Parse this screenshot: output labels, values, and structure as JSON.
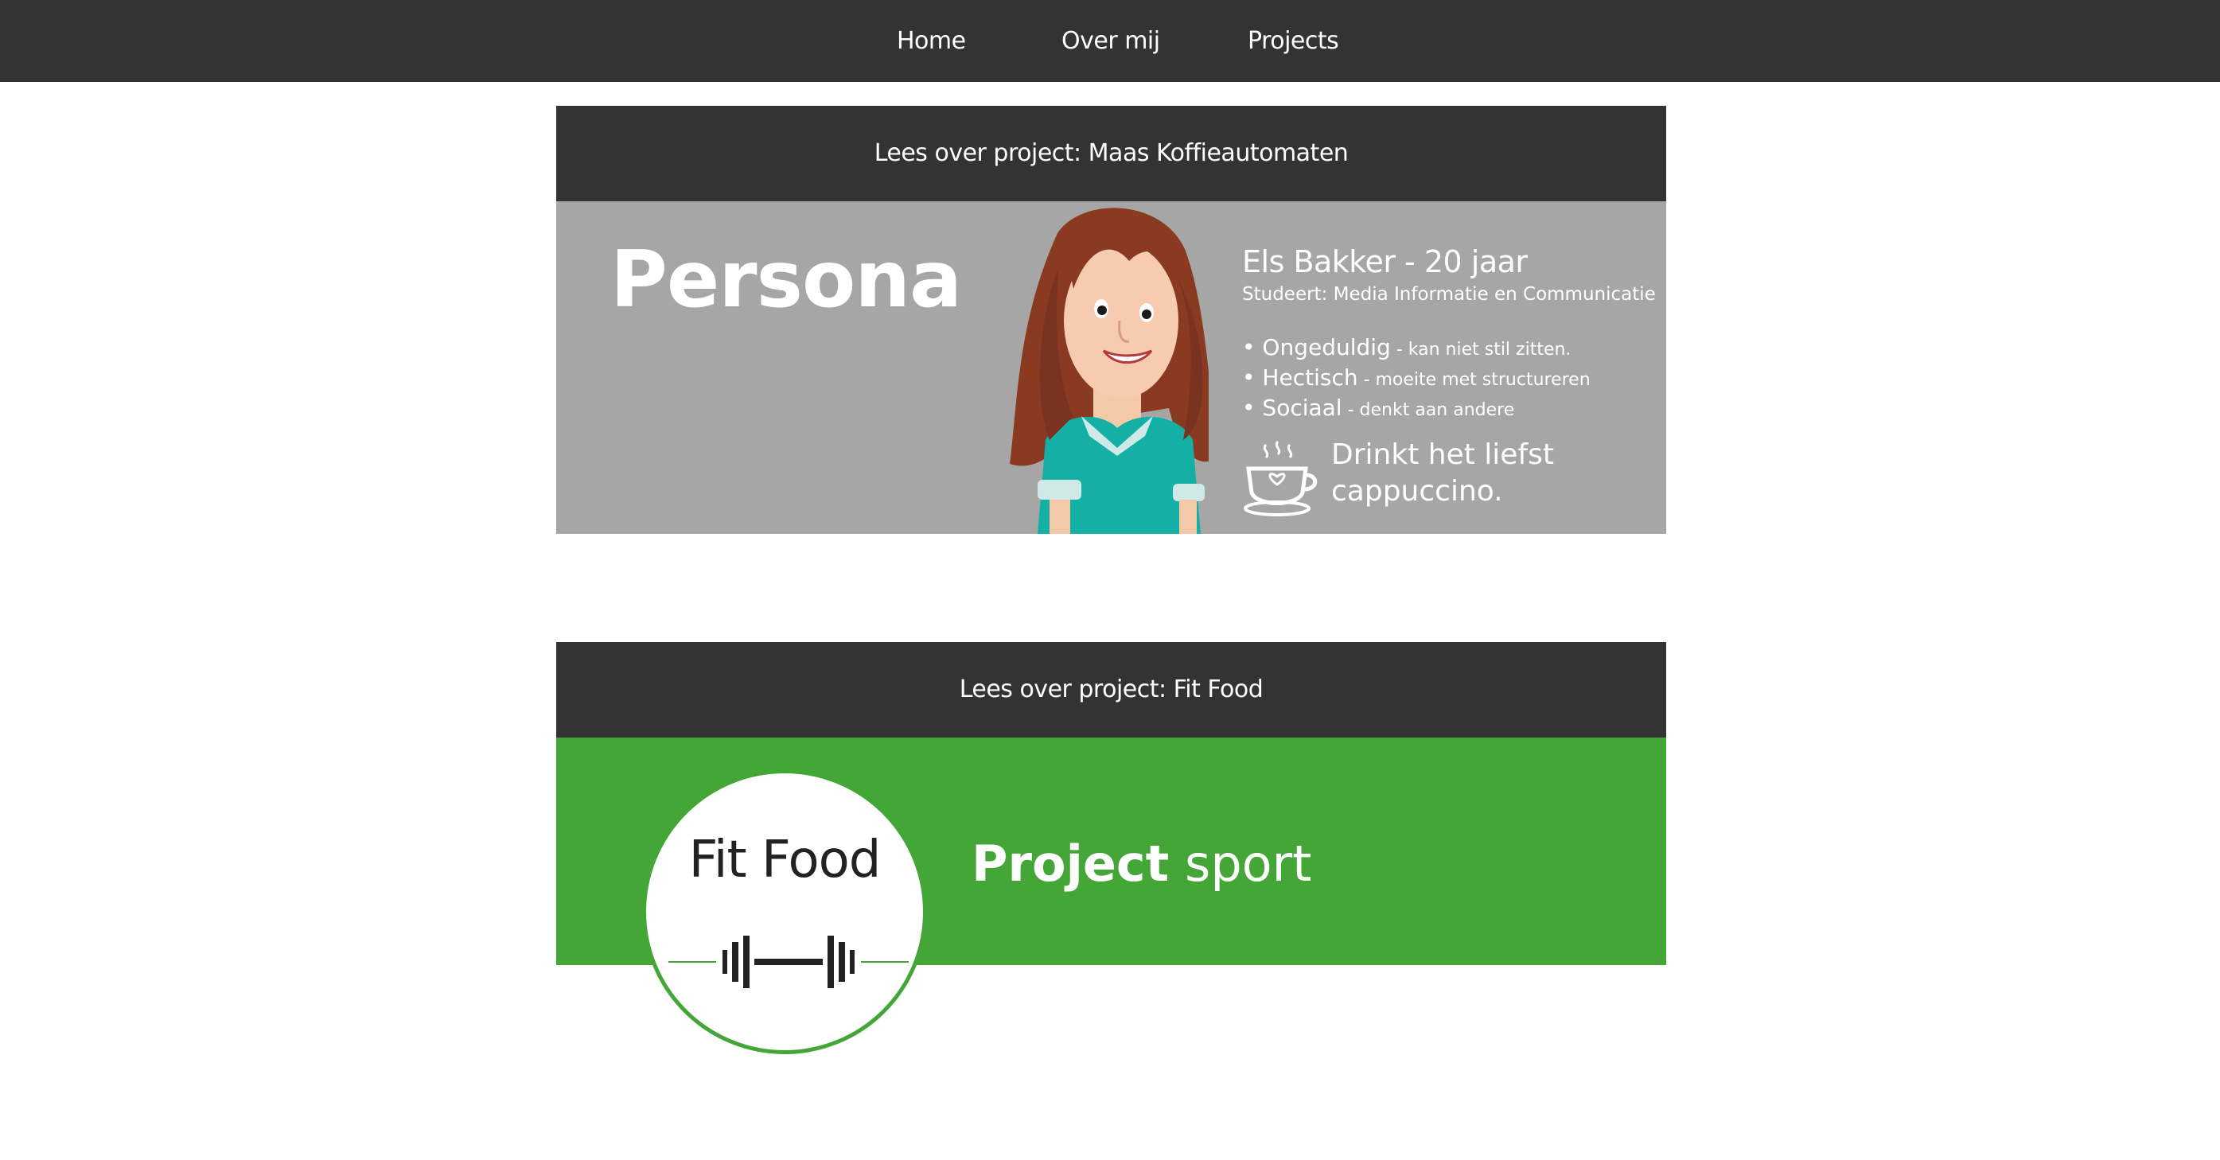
{
  "nav": {
    "items": [
      {
        "label": "Home"
      },
      {
        "label": "Over mij"
      },
      {
        "label": "Projects"
      }
    ]
  },
  "projects": [
    {
      "header": "Lees over project: Maas Koffieautomaten",
      "banner": {
        "title": "Persona",
        "name": "Els Bakker - 20 jaar",
        "study": "Studeert: Media Informatie en Communicatie",
        "traits": [
          {
            "trait": "• Ongeduldig",
            "desc": " - kan niet stil zitten."
          },
          {
            "trait": "• Hectisch",
            "desc": " - moeite met structureren"
          },
          {
            "trait": "• Sociaal",
            "desc": " - denkt aan andere"
          }
        ],
        "drink_line1": "Drinkt het liefst",
        "drink_line2": "cappuccino.",
        "bg_color": "#a7a6a7",
        "icon": "coffee-cup-icon"
      }
    },
    {
      "header": "Lees over project: Fit Food",
      "banner": {
        "logo_text": "Fit Food",
        "title_bold": "Project",
        "title_rest": " sport",
        "bg_color": "#43a637",
        "icon": "dumbbell-icon"
      }
    }
  ],
  "colors": {
    "nav_bg": "#333333",
    "text_light": "#ffffff",
    "green": "#43a637",
    "grey": "#a7a6a7"
  }
}
